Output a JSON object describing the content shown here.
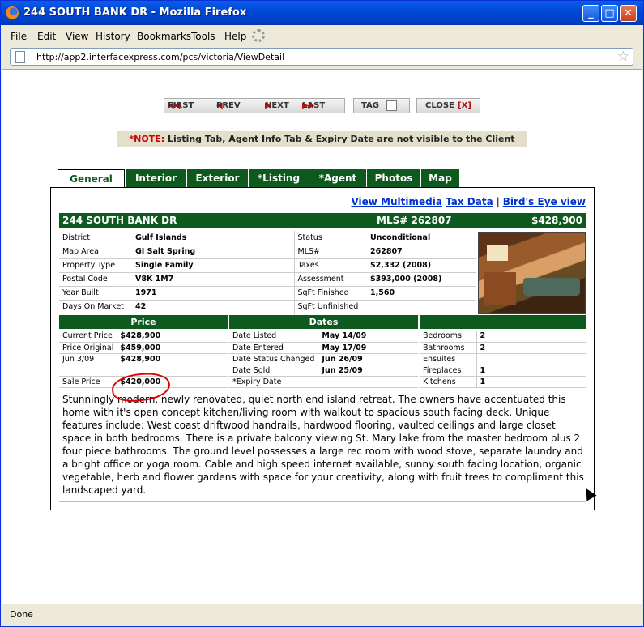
{
  "window": {
    "title": "244 SOUTH BANK DR - Mozilla Firefox"
  },
  "menu": [
    "File",
    "Edit",
    "View",
    "History",
    "Bookmarks",
    "Tools",
    "Help"
  ],
  "address_bar": {
    "url": "http://app2.interfacexpress.com/pcs/victoria/ViewDetail"
  },
  "status_bar": {
    "text": "Done"
  },
  "pager": {
    "first": "FIRST",
    "prev": "PREV",
    "next": "NEXT",
    "last": "LAST",
    "tag": "TAG",
    "close": "CLOSE",
    "close_x": "[X]"
  },
  "note": {
    "label": "*NOTE:",
    "text": "Listing Tab, Agent Info Tab & Expiry Date are not visible to the Client"
  },
  "tabs": [
    "General",
    "Interior",
    "Exterior",
    "*Listing",
    "*Agent",
    "Photos",
    "Map"
  ],
  "links": {
    "multimedia": "View Multimedia",
    "tax": "Tax Data",
    "sep": "|",
    "birdseye": "Bird's Eye view"
  },
  "header": {
    "address": "244 SOUTH BANK DR",
    "mls": "MLS# 262807",
    "price": "$428,900"
  },
  "info": {
    "left": [
      {
        "label": "District",
        "value": "Gulf Islands"
      },
      {
        "label": "Map Area",
        "value": "GI Salt Spring"
      },
      {
        "label": "Property Type",
        "value": "Single Family"
      },
      {
        "label": "Postal Code",
        "value": "V8K 1M7"
      },
      {
        "label": "Year Built",
        "value": "1971"
      },
      {
        "label": "Days On Market",
        "value": "42"
      }
    ],
    "right": [
      {
        "label": "Status",
        "value": "Unconditional"
      },
      {
        "label": "MLS#",
        "value": "262807"
      },
      {
        "label": "Taxes",
        "value": "$2,332 (2008)"
      },
      {
        "label": "Assessment",
        "value": "$393,000 (2008)"
      },
      {
        "label": "SqFt Finished",
        "value": "1,560"
      },
      {
        "label": "SqFt Unfinished",
        "value": ""
      }
    ]
  },
  "sections": {
    "price": "Price",
    "dates": "Dates",
    "rooms": ""
  },
  "prices": [
    {
      "label": "Current Price",
      "value": "$428,900"
    },
    {
      "label": "Price Original",
      "value": "$459,000"
    },
    {
      "label": "Jun 3/09",
      "value": "$428,900"
    },
    {
      "label": "",
      "value": ""
    },
    {
      "label": "Sale Price",
      "value": "$420,000"
    }
  ],
  "dates": [
    {
      "label": "Date Listed",
      "value": "May 14/09"
    },
    {
      "label": "Date Entered",
      "value": "May 17/09"
    },
    {
      "label": "Date Status Changed",
      "value": "Jun 26/09"
    },
    {
      "label": "Date Sold",
      "value": "Jun 25/09"
    },
    {
      "label": "*Expiry Date",
      "value": ""
    }
  ],
  "rooms": [
    {
      "label": "Bedrooms",
      "value": "2"
    },
    {
      "label": "Bathrooms",
      "value": "2"
    },
    {
      "label": "Ensuites",
      "value": ""
    },
    {
      "label": "Fireplaces",
      "value": "1"
    },
    {
      "label": "Kitchens",
      "value": "1"
    }
  ],
  "description": "Stunningly modern, newly renovated, quiet north end island retreat. The owners have accentuated this home with it's open concept kitchen/living room with walkout to spacious south facing deck. Unique features include: West coast driftwood handrails, hardwood flooring, vaulted ceilings and large closet space in both bedrooms. There is a private balcony viewing St. Mary lake from the master bedroom plus 2 four piece bathrooms. The ground level possesses a large rec room with wood stove, separate laundry and a bright office or yoga room. Cable and high speed internet available, sunny south facing location, organic vegetable, herb and flower gardens with space for your creativity, along with fruit trees to compliment this landscaped yard.",
  "colors": {
    "header_green": "#0e5a1e",
    "link_blue": "#0033cc",
    "note_red": "#cc0000",
    "annotation_red": "#dd0000"
  }
}
